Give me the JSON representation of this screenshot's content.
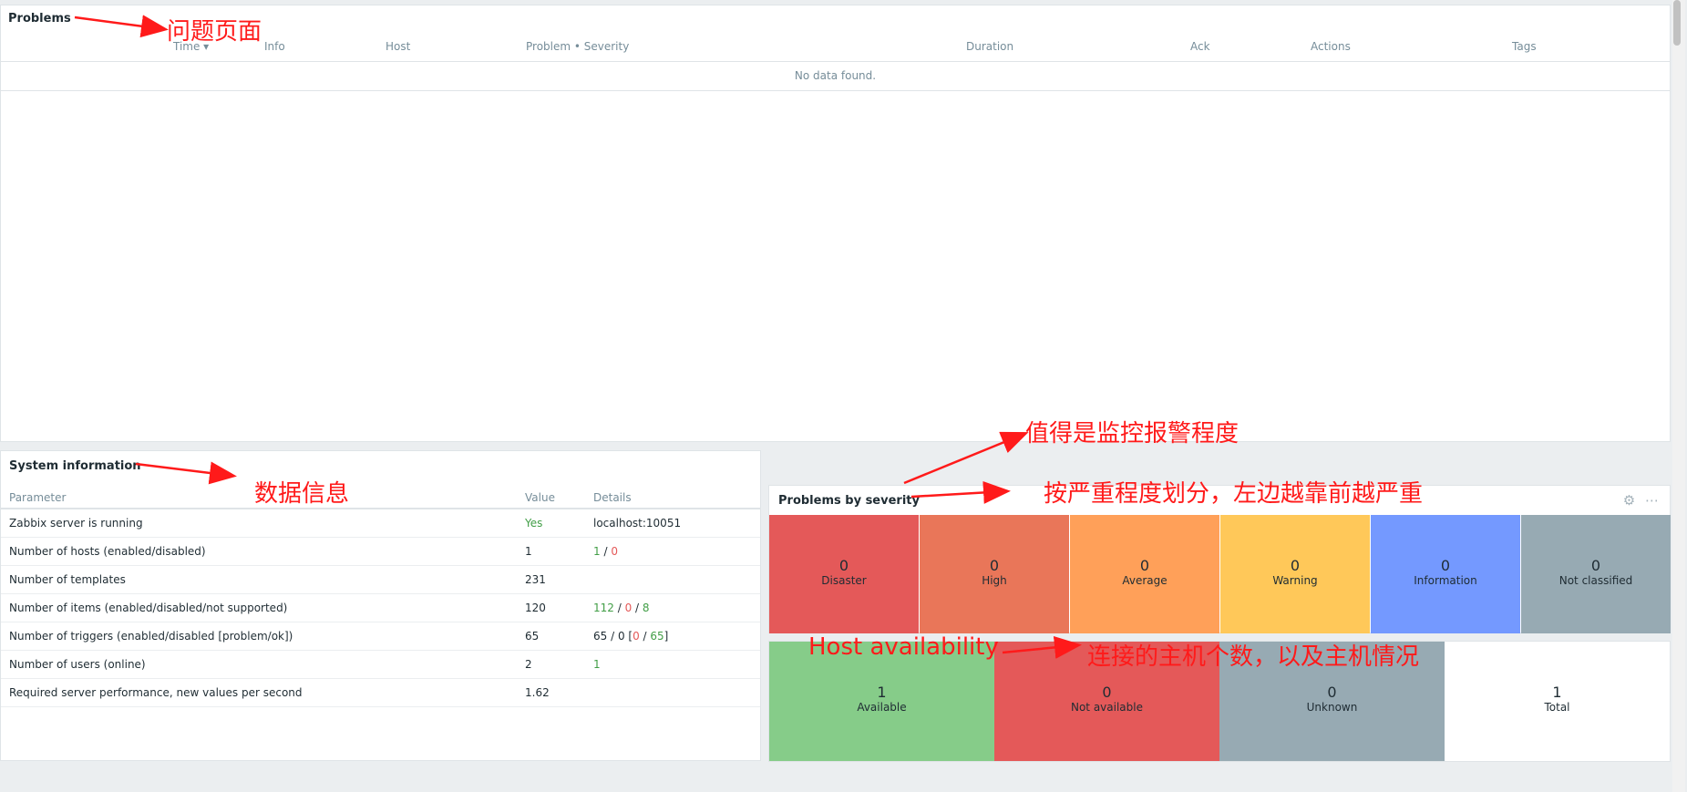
{
  "problems": {
    "title": "Problems",
    "columns": [
      "Time ▾",
      "Info",
      "Host",
      "Problem • Severity",
      "Duration",
      "Ack",
      "Actions",
      "Tags"
    ],
    "empty": "No data found."
  },
  "system_info": {
    "title": "System information",
    "headers": [
      "Parameter",
      "Value",
      "Details"
    ],
    "rows": [
      {
        "param": "Zabbix server is running",
        "value": "Yes",
        "detail": "localhost:10051"
      },
      {
        "param": "Number of hosts (enabled/disabled)",
        "value": "1",
        "d1": "1",
        "d2": "0"
      },
      {
        "param": "Number of templates",
        "value": "231"
      },
      {
        "param": "Number of items (enabled/disabled/not supported)",
        "value": "120",
        "d1": "112",
        "d2": "0",
        "d3": "8"
      },
      {
        "param": "Number of triggers (enabled/disabled [problem/ok])",
        "value": "65",
        "d1": "65 / 0 [",
        "d2": "0",
        "d3": "65",
        "d4": "]"
      },
      {
        "param": "Number of users (online)",
        "value": "2",
        "d1": "1"
      },
      {
        "param": "Required server performance, new values per second",
        "value": "1.62"
      }
    ]
  },
  "severity": {
    "title": "Problems by severity",
    "tiles": [
      {
        "count": "0",
        "label": "Disaster",
        "color": "#e45959"
      },
      {
        "count": "0",
        "label": "High",
        "color": "#e97659"
      },
      {
        "count": "0",
        "label": "Average",
        "color": "#ffa059"
      },
      {
        "count": "0",
        "label": "Warning",
        "color": "#ffc859"
      },
      {
        "count": "0",
        "label": "Information",
        "color": "#7499ff"
      },
      {
        "count": "0",
        "label": "Not classified",
        "color": "#97aab3"
      }
    ]
  },
  "host_availability": {
    "tiles": [
      {
        "count": "1",
        "label": "Available",
        "color": "#86cc89"
      },
      {
        "count": "0",
        "label": "Not available",
        "color": "#e45959"
      },
      {
        "count": "0",
        "label": "Unknown",
        "color": "#97aab3"
      },
      {
        "count": "1",
        "label": "Total",
        "color": "#ffffff"
      }
    ]
  },
  "annotations": {
    "problems_page": "问题页面",
    "data_info": "数据信息",
    "alert_degree": "值得是监控报警程度",
    "severity_note": "按严重程度划分，左边越靠前越严重",
    "host_availability": "Host availability",
    "host_note": "连接的主机个数，以及主机情况"
  }
}
